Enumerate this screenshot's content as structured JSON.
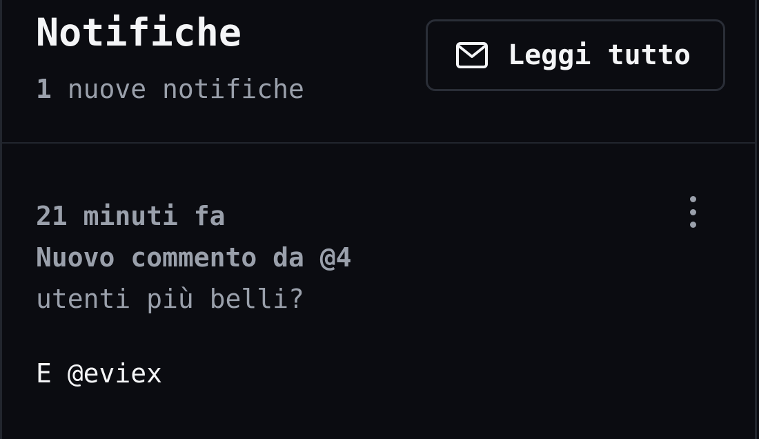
{
  "header": {
    "title": "Notifiche",
    "new_count": "1",
    "new_label": " nuove notifiche",
    "read_all": {
      "label": "Leggi tutto",
      "icon": "mail-icon"
    }
  },
  "notifications": [
    {
      "time": "21 minuti fa",
      "title": "Nuovo commento da @4",
      "body": "utenti più belli?",
      "author": "E @eviex",
      "menu_icon": "kebab-menu-icon"
    }
  ],
  "colors": {
    "background": "#0b0c11",
    "border": "#22262e",
    "text_primary": "#f4f5f7",
    "text_muted": "#9aa0ab"
  }
}
